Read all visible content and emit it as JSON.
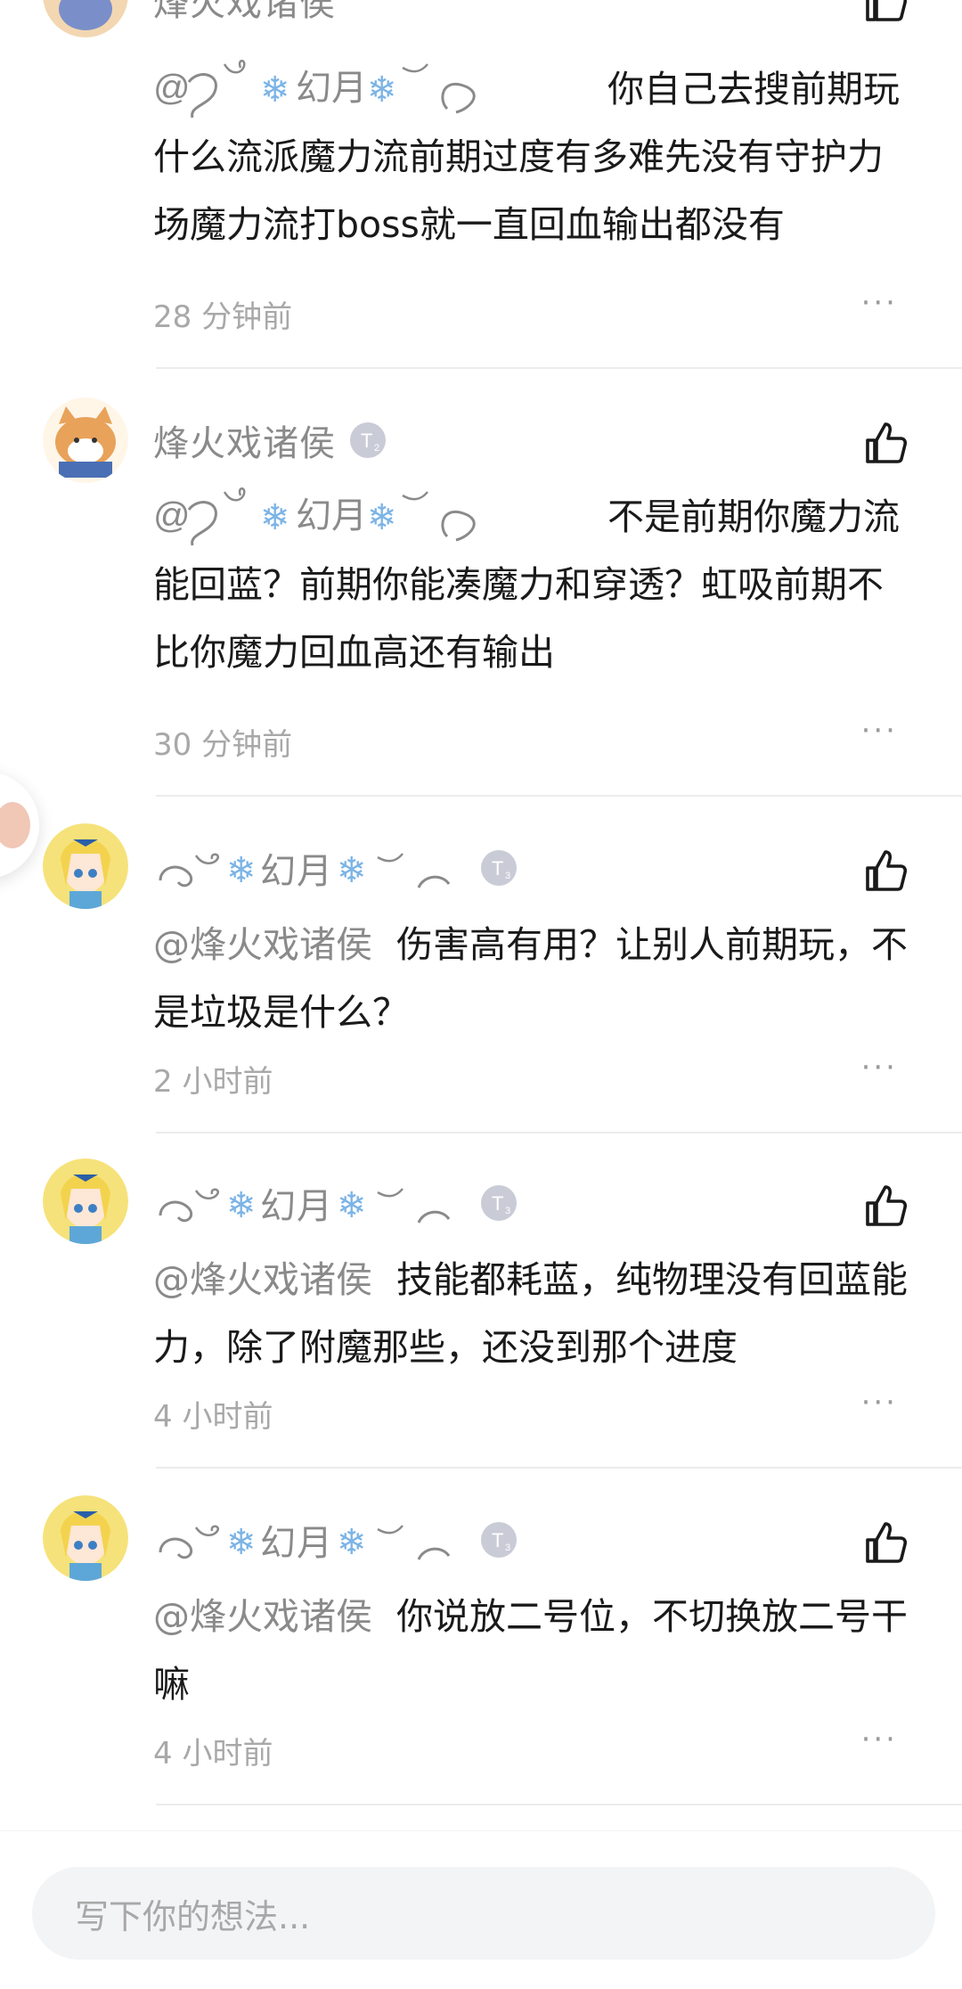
{
  "comments": [
    {
      "username": "烽火戏诸侯",
      "reply_to": "@⟆༄✿❄幻月❄༄⟆",
      "text": "你自己去搜前期玩什么流派魔力流前期过度有多难先没有守护力场魔力流打boss就一直回血输出都没有",
      "time": "28 分钟前",
      "more": "···"
    },
    {
      "username": "烽火戏诸侯",
      "reply_to": "@⟆༄✿❄幻月❄༄⟆",
      "text": "不是前期你魔力流能回蓝？前期你能凑魔力和穿透？虹吸前期不比你魔力回血高还有输出",
      "time": "30 分钟前",
      "more": "···"
    },
    {
      "username": "幻月",
      "reply_to": "@烽火戏诸侯",
      "text": "伤害高有用？让别人前期玩，不是垃圾是什么？",
      "time": "2 小时前",
      "more": "···"
    },
    {
      "username": "幻月",
      "reply_to": "@烽火戏诸侯",
      "text": "技能都耗蓝，纯物理没有回蓝能力，除了附魔那些，还没到那个进度",
      "time": "4 小时前",
      "more": "···"
    },
    {
      "username": "幻月",
      "reply_to": "@烽火戏诸侯",
      "text": "你说放二号位，不切换放二号干嘛",
      "time": "4 小时前",
      "more": "···"
    }
  ],
  "input": {
    "placeholder": "写下你的想法..."
  },
  "icons": {
    "like": "thumbs-up-icon",
    "more": "more-dots-icon",
    "level": "level-badge-icon"
  },
  "colors": {
    "muted": "#8a8a8a",
    "text": "#1a1a1a",
    "input_bg": "#f3f4f6",
    "snow": "#7cb4e6"
  }
}
